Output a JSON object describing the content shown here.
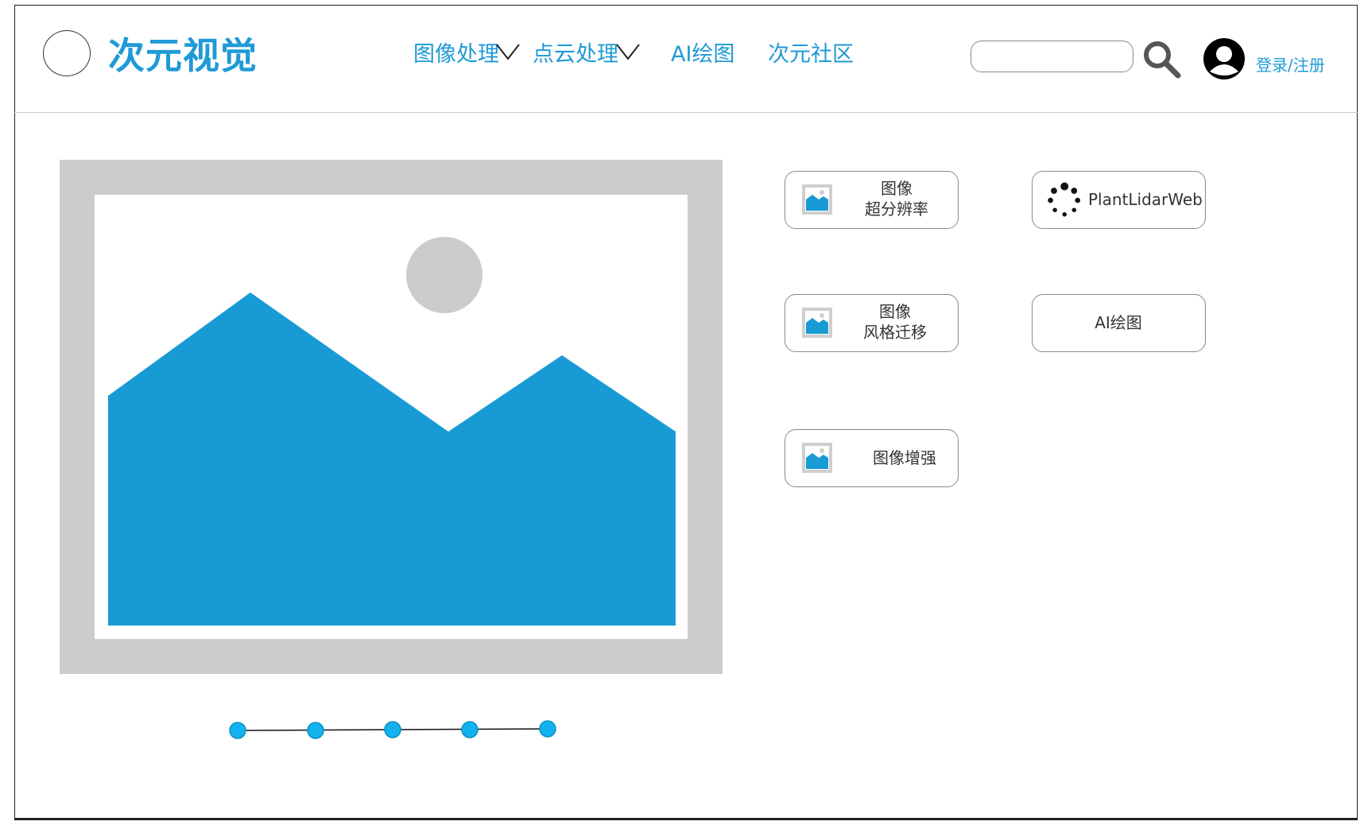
{
  "brand": {
    "name": "次元视觉"
  },
  "nav": {
    "items": [
      {
        "label": "图像处理",
        "has_dropdown": true
      },
      {
        "label": "点云处理",
        "has_dropdown": true
      },
      {
        "label": "AI绘图",
        "has_dropdown": false
      },
      {
        "label": "次元社区",
        "has_dropdown": false
      }
    ]
  },
  "search": {
    "value": "",
    "placeholder": "",
    "icon": "search-icon"
  },
  "account": {
    "login_label": "登录/注册",
    "icon": "user-avatar-icon"
  },
  "hero": {
    "icon": "image-placeholder-icon"
  },
  "carousel": {
    "slide_count": 5,
    "active_index": 0
  },
  "features": [
    {
      "line1": "图像",
      "line2": "超分辨率",
      "icon": "image-icon"
    },
    {
      "line1": "PlantLidarWeb",
      "line2": "",
      "icon": "loading-dots-icon"
    },
    {
      "line1": "图像",
      "line2": "风格迁移",
      "icon": "image-icon"
    },
    {
      "line1": "AI绘图",
      "line2": "",
      "icon": ""
    },
    {
      "line1": "图像增强",
      "line2": "",
      "icon": "image-icon"
    }
  ],
  "colors": {
    "accent": "#1f9ad6",
    "image_blue": "#189bd5",
    "placeholder_gray": "#cccccc",
    "dot_blue": "#13b2ee"
  }
}
